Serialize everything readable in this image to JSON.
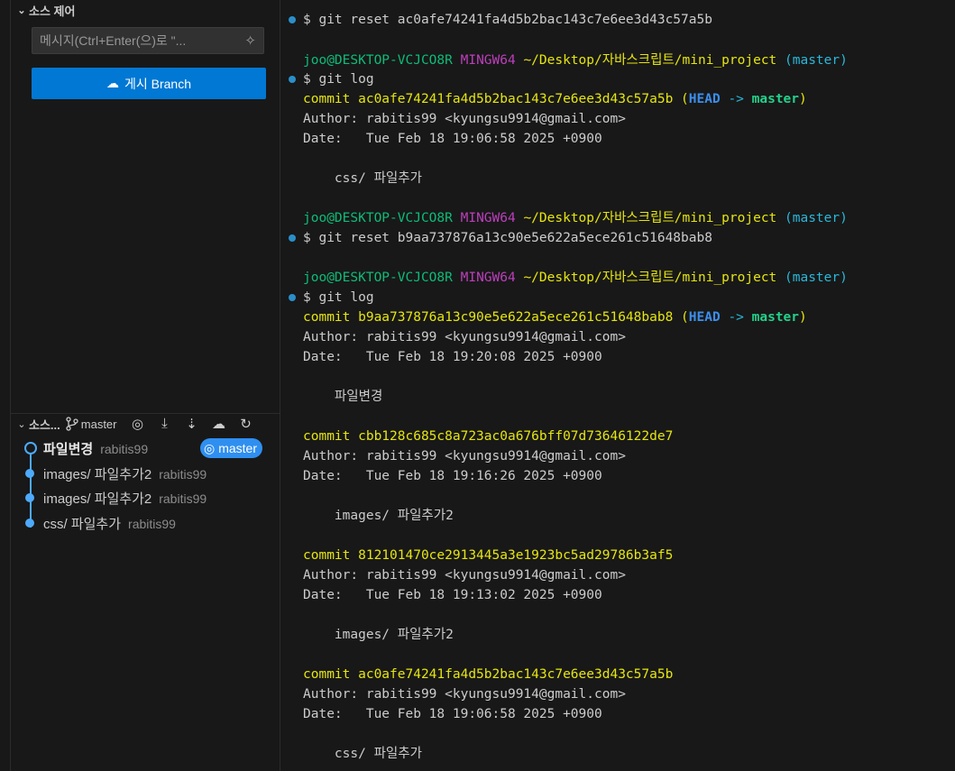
{
  "sidebar": {
    "source_control_title": "소스 제어",
    "message_placeholder": "메시지(Ctrl+Enter(으)로 \"...",
    "publish_button": "게시 Branch",
    "graph_title": "소스...",
    "graph_branch": "master",
    "graph_rows": [
      {
        "message": "파일변경",
        "author": "rabitis99",
        "badge": "master"
      },
      {
        "message": "images/ 파일추가2",
        "author": "rabitis99"
      },
      {
        "message": "images/ 파일추가2",
        "author": "rabitis99"
      },
      {
        "message": "css/ 파일추가",
        "author": "rabitis99"
      }
    ]
  },
  "terminal": {
    "prompt_user": "joo@DESKTOP-VCJCO8R",
    "prompt_env": "MINGW64",
    "prompt_path": "~/Desktop/자바스크립트/mini_project",
    "prompt_branch": "(master)",
    "cmd1": "$ git reset ac0afe74241fa4d5b2bac143c7e6ee3d43c57a5b",
    "cmd2": "$ git log",
    "cmd3": "$ git reset b9aa737876a13c90e5e622a5ece261c51648bab8",
    "cmd4": "$ git log",
    "log1": {
      "commit": "commit ac0afe74241fa4d5b2bac143c7e6ee3d43c57a5b",
      "head": "HEAD",
      "arrow": "->",
      "branch": "master",
      "author": "Author: rabitis99 <kyungsu9914@gmail.com>",
      "date": "Date:   Tue Feb 18 19:06:58 2025 +0900",
      "message": "    css/ 파일추가"
    },
    "log2": [
      {
        "commit": "commit b9aa737876a13c90e5e622a5ece261c51648bab8",
        "head": "HEAD",
        "arrow": "->",
        "branch": "master",
        "author": "Author: rabitis99 <kyungsu9914@gmail.com>",
        "date": "Date:   Tue Feb 18 19:20:08 2025 +0900",
        "message": "    파일변경"
      },
      {
        "commit": "commit cbb128c685c8a723ac0a676bff07d73646122de7",
        "author": "Author: rabitis99 <kyungsu9914@gmail.com>",
        "date": "Date:   Tue Feb 18 19:16:26 2025 +0900",
        "message": "    images/ 파일추가2"
      },
      {
        "commit": "commit 812101470ce2913445a3e1923bc5ad29786b3af5",
        "author": "Author: rabitis99 <kyungsu9914@gmail.com>",
        "date": "Date:   Tue Feb 18 19:13:02 2025 +0900",
        "message": "    images/ 파일추가2"
      },
      {
        "commit": "commit ac0afe74241fa4d5b2bac143c7e6ee3d43c57a5b",
        "author": "Author: rabitis99 <kyungsu9914@gmail.com>",
        "date": "Date:   Tue Feb 18 19:06:58 2025 +0900",
        "message": "    css/ 파일추가"
      }
    ]
  }
}
